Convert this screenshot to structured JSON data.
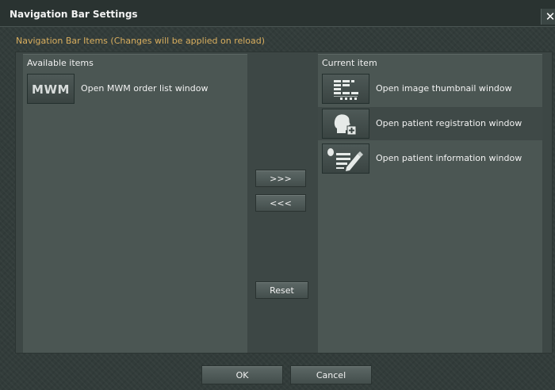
{
  "dialog": {
    "title": "Navigation Bar Settings",
    "close_glyph": "✕",
    "section_title": "Navigation Bar Items (Changes will be applied on reload)"
  },
  "available": {
    "header": "Available items",
    "items": [
      {
        "label": "Open MWM order list window",
        "icon": "mwm-icon",
        "icon_text": "MWM"
      }
    ]
  },
  "current": {
    "header": "Current item",
    "items": [
      {
        "label": "Open image thumbnail window",
        "icon": "thumbnail-grid-icon"
      },
      {
        "label": "Open patient registration window",
        "icon": "patient-add-icon"
      },
      {
        "label": "Open patient information window",
        "icon": "patient-info-edit-icon"
      }
    ]
  },
  "controls": {
    "add_label": ">>>",
    "remove_label": "<<<",
    "reset_label": "Reset"
  },
  "footer": {
    "ok_label": "OK",
    "cancel_label": "Cancel"
  },
  "colors": {
    "section_title": "#d9ae5e",
    "dialog_background": "#323c3a",
    "panel_background": "#4b5653"
  }
}
